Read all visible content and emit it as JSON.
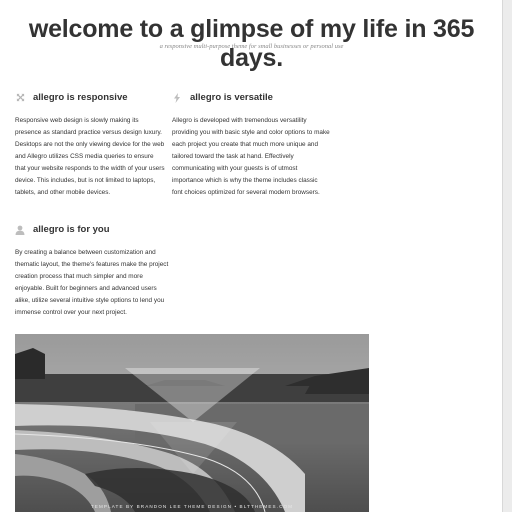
{
  "header": {
    "title": "welcome to a glimpse of my life in 365 days.",
    "tagline": "a responsive multi-purpose theme for small businesses or personal use"
  },
  "features": [
    {
      "icon": "resize-arrows-icon",
      "title": "allegro is responsive",
      "body": "Responsive web design is slowly making its presence as standard practice versus design luxury. Desktops are not the only viewing device for the web and Allegro utilizes CSS media queries to ensure that your website responds to the width of your users device. This includes, but is not limited to laptops, tablets, and other mobile devices."
    },
    {
      "icon": "lightning-bolt-icon",
      "title": "allegro is versatile",
      "body": "Allegro is developed with tremendous versatility providing you with basic style and color options to make each project you create that much more unique and tailored toward the task at hand. Effectively communicating with your guests is of utmost importance which is why the theme includes classic font choices optimized for several modern browsers."
    },
    {
      "icon": "user-icon",
      "title": "allegro is for you",
      "body": "By creating a balance between customization and thematic layout, the theme's features make the project creation process that much simpler and more enjoyable. Built for beginners and advanced users alike, utilize several intuitive style options to lend you immense control over your next project."
    }
  ],
  "banner": {
    "credit": "TEMPLATE BY BRANDON LEE THEME DESIGN • BLTTHEMES.COM"
  }
}
